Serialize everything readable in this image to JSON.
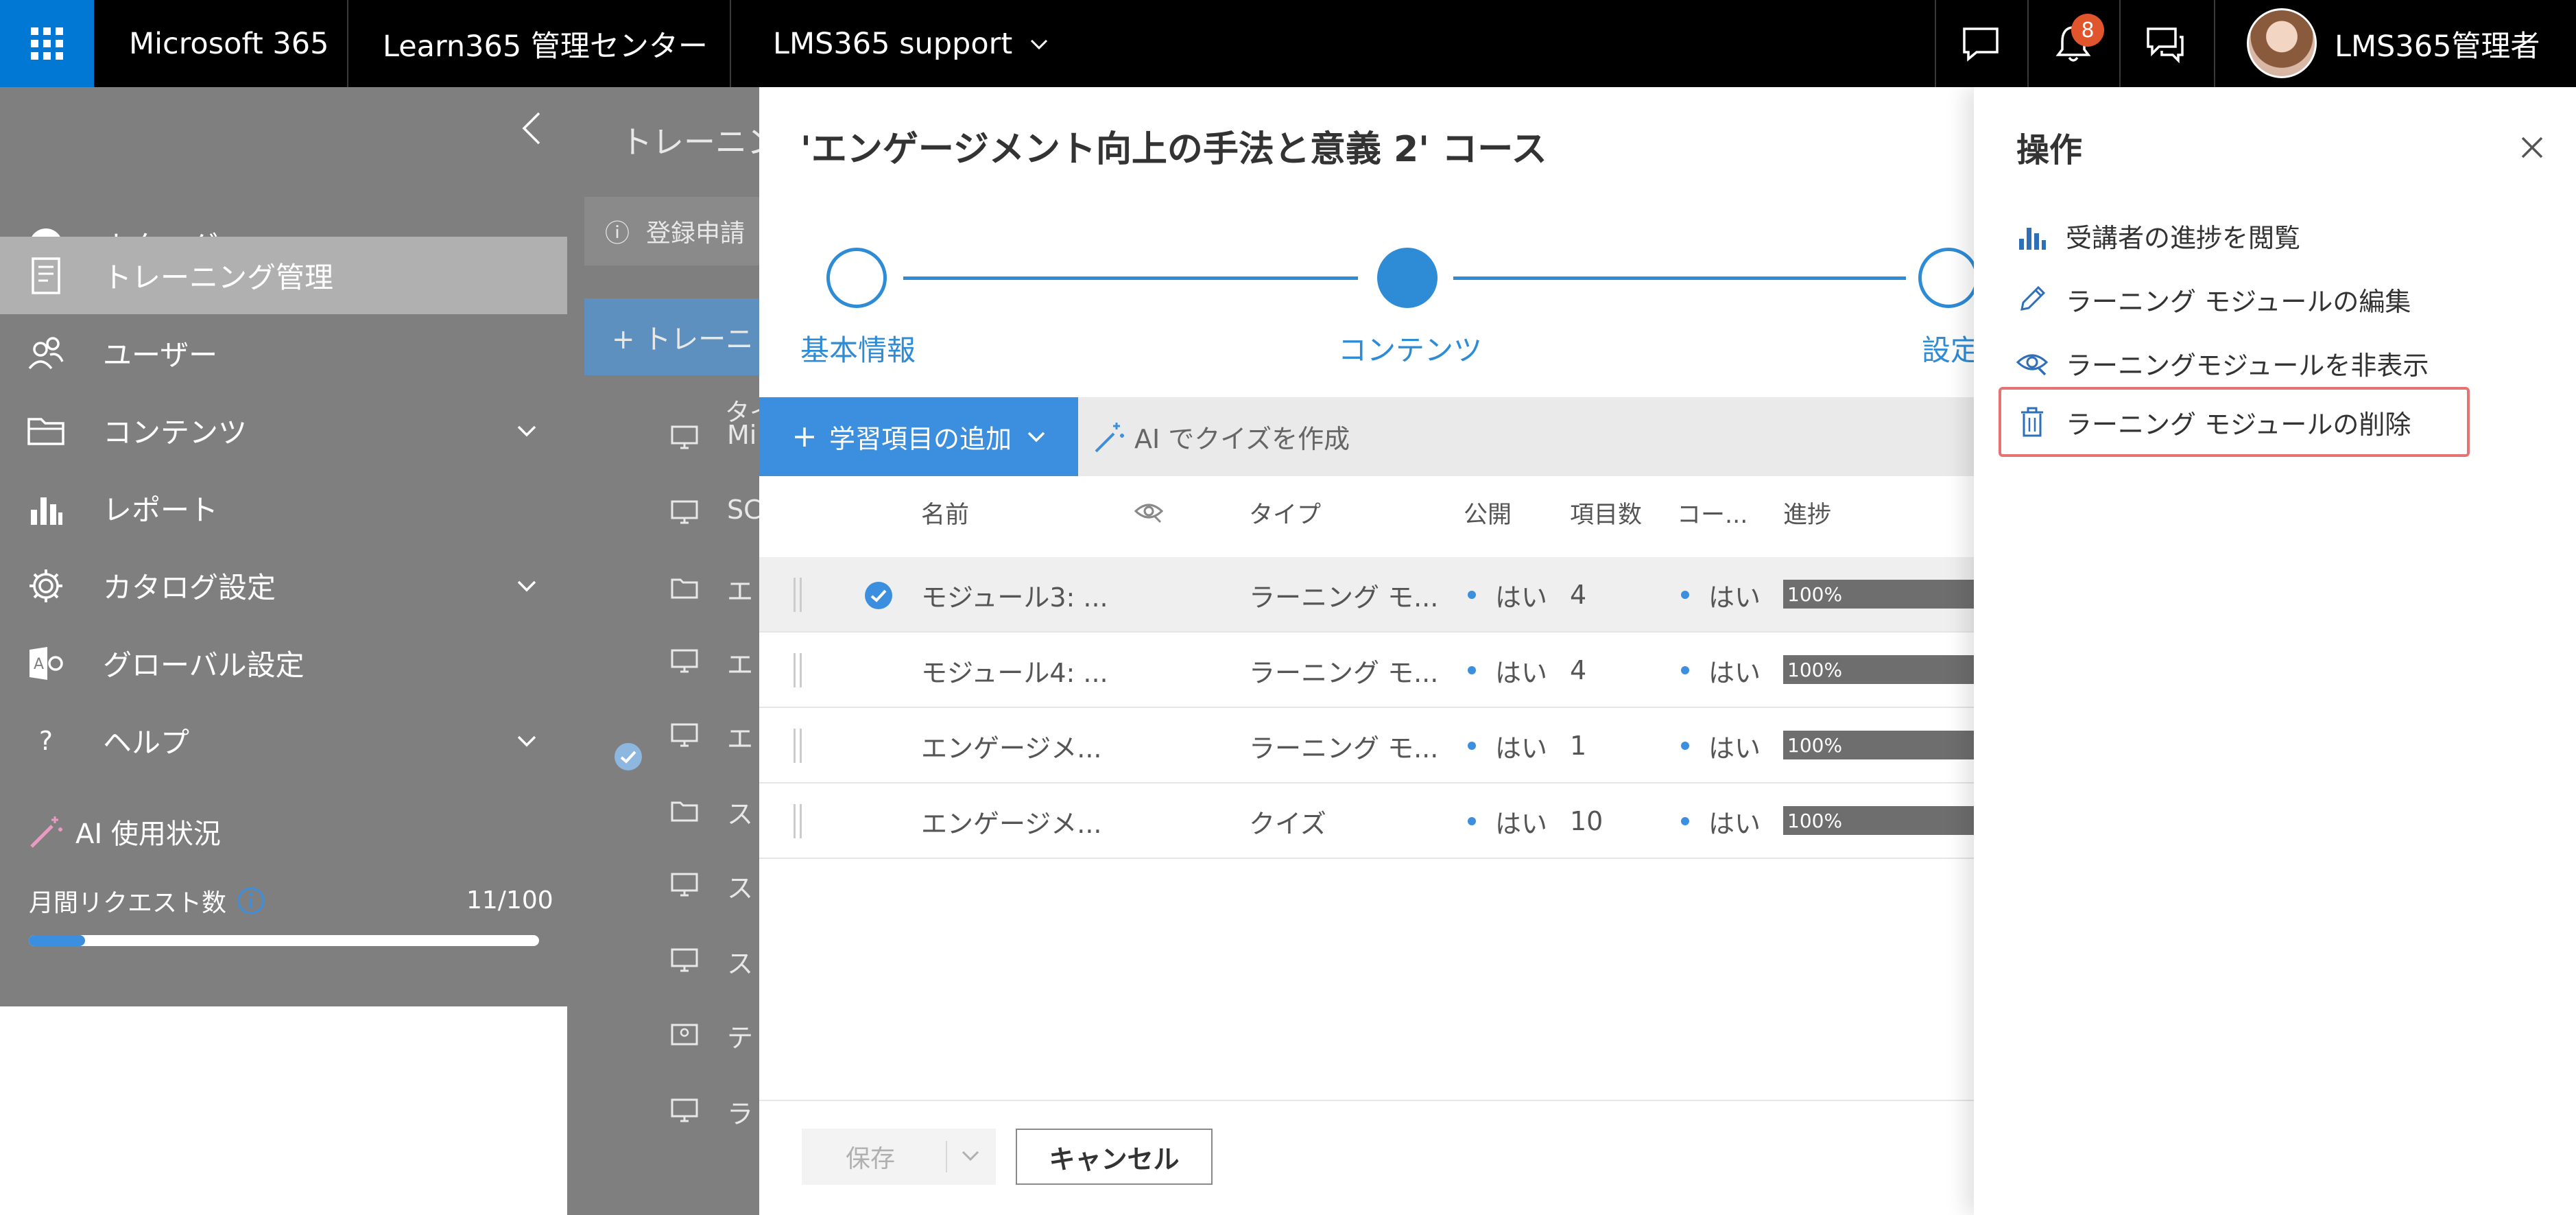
{
  "topbar": {
    "app_name": "Microsoft 365",
    "center_name": "Learn365 管理センター",
    "tenant": "LMS365 support",
    "notification_count": "8",
    "user_name": "LMS365管理者"
  },
  "sidebar": {
    "items": [
      {
        "label": "カタログへ",
        "icon": "check-circle-icon"
      },
      {
        "label": "トレーニング管理",
        "icon": "training-icon"
      },
      {
        "label": "ユーザー",
        "icon": "users-icon"
      },
      {
        "label": "コンテンツ",
        "icon": "folder-icon"
      },
      {
        "label": "レポート",
        "icon": "chart-icon"
      },
      {
        "label": "カタログ設定",
        "icon": "gear-icon"
      },
      {
        "label": "グローバル設定",
        "icon": "global-settings-icon"
      },
      {
        "label": "ヘルプ",
        "icon": "help-icon"
      }
    ],
    "ai_usage_title": "AI 使用状況",
    "monthly_requests_label": "月間リクエスト数",
    "monthly_requests_value": "11/100",
    "usage_fraction": 0.11
  },
  "background": {
    "page_title": "トレーニン",
    "info_text": "登録申請",
    "new_button": "+ トレーニ",
    "col_header": "タイ",
    "rows": [
      "Mi",
      "SC",
      "エ",
      "エ",
      "エ",
      "ス",
      "ス",
      "ス",
      "テ",
      "ラ"
    ]
  },
  "modal": {
    "title": "'エンゲージメント向上の手法と意義 2' コース",
    "steps": [
      "基本情報",
      "コンテンツ",
      "設定"
    ],
    "add_item_button": "学習項目の追加",
    "ai_quiz_button": "AI でクイズを作成",
    "columns": {
      "name": "名前",
      "type": "タイプ",
      "published": "公開",
      "items": "項目数",
      "completion": "コー...",
      "progress": "進捗"
    },
    "rows": [
      {
        "name": "モジュール3: ...",
        "type": "ラーニング モ...",
        "published": "はい",
        "items": "4",
        "completion": "はい",
        "progress": "100%",
        "selected": true
      },
      {
        "name": "モジュール4: ...",
        "type": "ラーニング モ...",
        "published": "はい",
        "items": "4",
        "completion": "はい",
        "progress": "100%",
        "selected": false
      },
      {
        "name": "エンゲージメ...",
        "type": "ラーニング モ...",
        "published": "はい",
        "items": "1",
        "completion": "はい",
        "progress": "100%",
        "selected": false
      },
      {
        "name": "エンゲージメ...",
        "type": "クイズ",
        "published": "はい",
        "items": "10",
        "completion": "はい",
        "progress": "100%",
        "selected": false
      }
    ],
    "save_button": "保存",
    "cancel_button": "キャンセル"
  },
  "actions_panel": {
    "title": "操作",
    "items": [
      {
        "label": "受講者の進捗を閲覧",
        "icon": "bar-chart-icon"
      },
      {
        "label": "ラーニング モジュールの編集",
        "icon": "pencil-icon"
      },
      {
        "label": "ラーニングモジュールを非表示",
        "icon": "hide-icon"
      },
      {
        "label": "ラーニング モジュールの削除",
        "icon": "trash-icon"
      }
    ]
  },
  "colors": {
    "accent": "#3b8fde",
    "topbar": "#000000",
    "waffle": "#0078d4",
    "sidebar": "#7f7f7f",
    "highlight_border": "#e57373",
    "badge": "#e0552b"
  }
}
